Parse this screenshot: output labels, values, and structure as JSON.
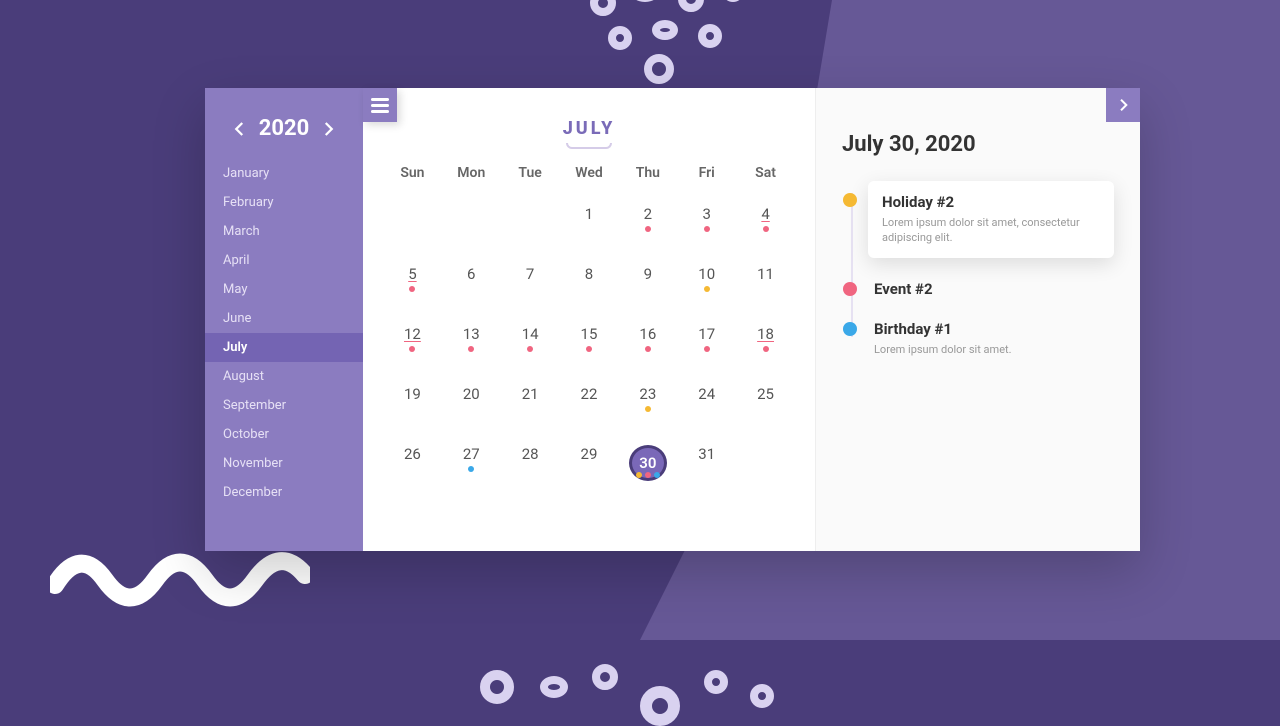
{
  "year": "2020",
  "months": [
    "January",
    "February",
    "March",
    "April",
    "May",
    "June",
    "July",
    "August",
    "September",
    "October",
    "November",
    "December"
  ],
  "active_month_index": 6,
  "cal_title": "JULY",
  "dow": [
    "Sun",
    "Mon",
    "Tue",
    "Wed",
    "Thu",
    "Fri",
    "Sat"
  ],
  "days": [
    {
      "n": "",
      "dots": []
    },
    {
      "n": "",
      "dots": []
    },
    {
      "n": "",
      "dots": []
    },
    {
      "n": "1",
      "dots": []
    },
    {
      "n": "2",
      "dots": [
        "red"
      ]
    },
    {
      "n": "3",
      "dots": [
        "red"
      ]
    },
    {
      "n": "4",
      "dots": [
        "red"
      ],
      "weekend": true
    },
    {
      "n": "5",
      "dots": [
        "red"
      ],
      "weekend": true
    },
    {
      "n": "6",
      "dots": []
    },
    {
      "n": "7",
      "dots": []
    },
    {
      "n": "8",
      "dots": []
    },
    {
      "n": "9",
      "dots": []
    },
    {
      "n": "10",
      "dots": [
        "yellow"
      ]
    },
    {
      "n": "11",
      "dots": []
    },
    {
      "n": "12",
      "dots": [
        "red"
      ],
      "weekend": true
    },
    {
      "n": "13",
      "dots": [
        "red"
      ]
    },
    {
      "n": "14",
      "dots": [
        "red"
      ]
    },
    {
      "n": "15",
      "dots": [
        "red"
      ]
    },
    {
      "n": "16",
      "dots": [
        "red"
      ]
    },
    {
      "n": "17",
      "dots": [
        "red"
      ]
    },
    {
      "n": "18",
      "dots": [
        "red"
      ],
      "weekend": true
    },
    {
      "n": "19",
      "dots": []
    },
    {
      "n": "20",
      "dots": []
    },
    {
      "n": "21",
      "dots": []
    },
    {
      "n": "22",
      "dots": []
    },
    {
      "n": "23",
      "dots": [
        "yellow"
      ]
    },
    {
      "n": "24",
      "dots": []
    },
    {
      "n": "25",
      "dots": []
    },
    {
      "n": "26",
      "dots": []
    },
    {
      "n": "27",
      "dots": [
        "blue"
      ]
    },
    {
      "n": "28",
      "dots": []
    },
    {
      "n": "29",
      "dots": []
    },
    {
      "n": "30",
      "dots": [
        "yellow",
        "red",
        "blue"
      ],
      "selected": true
    },
    {
      "n": "31",
      "dots": []
    },
    {
      "n": "",
      "dots": []
    }
  ],
  "panel": {
    "date": "July 30, 2020",
    "events": [
      {
        "color": "yellow",
        "title": "Holiday #2",
        "desc": "Lorem ipsum dolor sit amet, consectetur adipiscing elit.",
        "card": true
      },
      {
        "color": "red",
        "title": "Event #2",
        "desc": ""
      },
      {
        "color": "blue",
        "title": "Birthday #1",
        "desc": "Lorem ipsum dolor sit amet."
      }
    ]
  }
}
